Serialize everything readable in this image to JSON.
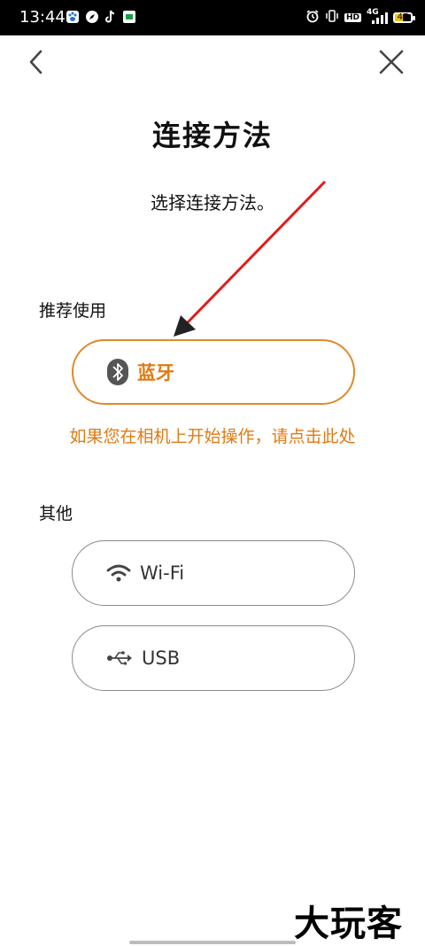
{
  "status_bar": {
    "time": "13:44",
    "network": "4G",
    "hd_label": "HD",
    "battery_level": "47"
  },
  "nav": {
    "back_icon": "chevron-left-icon",
    "close_icon": "close-icon"
  },
  "page": {
    "title": "连接方法",
    "subtitle": "选择连接方法。"
  },
  "recommended": {
    "label": "推荐使用",
    "bluetooth_label": "蓝牙",
    "camera_link": "如果您在相机上开始操作，请点击此处"
  },
  "other": {
    "label": "其他",
    "wifi_label": "Wi-Fi",
    "usb_label": "USB"
  },
  "watermark": "大玩客",
  "colors": {
    "accent": "#e07a12",
    "arrow": "#e31b1b"
  }
}
